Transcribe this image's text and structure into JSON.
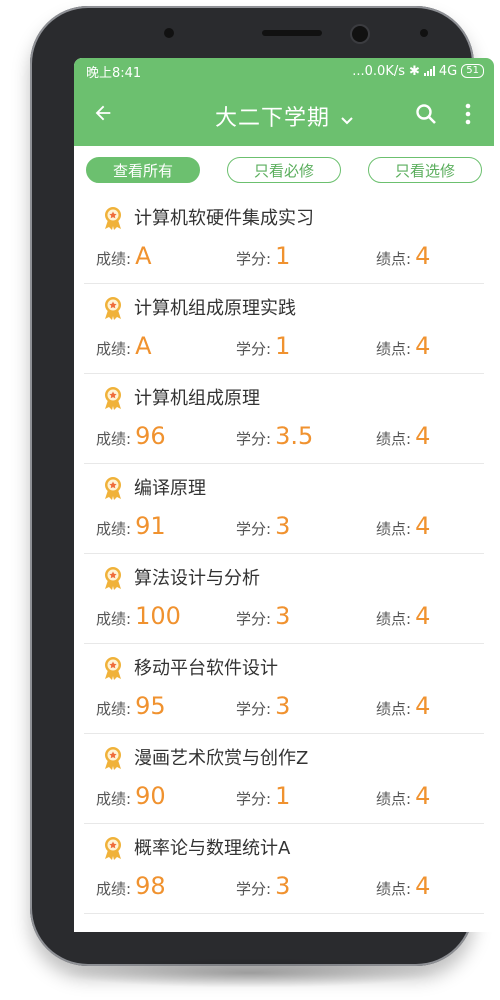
{
  "status": {
    "time": "晚上8:41",
    "net": "...0.0K/s",
    "signal": "4G",
    "battery": "51"
  },
  "header": {
    "title": "大二下学期"
  },
  "filters": [
    {
      "label": "查看所有",
      "active": true
    },
    {
      "label": "只看必修",
      "active": false
    },
    {
      "label": "只看选修",
      "active": false
    }
  ],
  "labels": {
    "score": "成绩:",
    "credit": "学分:",
    "gpa": "绩点:"
  },
  "courses": [
    {
      "name": "计算机软硬件集成实习",
      "score": "A",
      "credit": "1",
      "gpa": "4"
    },
    {
      "name": "计算机组成原理实践",
      "score": "A",
      "credit": "1",
      "gpa": "4"
    },
    {
      "name": "计算机组成原理",
      "score": "96",
      "credit": "3.5",
      "gpa": "4"
    },
    {
      "name": "编译原理",
      "score": "91",
      "credit": "3",
      "gpa": "4"
    },
    {
      "name": "算法设计与分析",
      "score": "100",
      "credit": "3",
      "gpa": "4"
    },
    {
      "name": "移动平台软件设计",
      "score": "95",
      "credit": "3",
      "gpa": "4"
    },
    {
      "name": "漫画艺术欣赏与创作Z",
      "score": "90",
      "credit": "1",
      "gpa": "4"
    },
    {
      "name": "概率论与数理统计A",
      "score": "98",
      "credit": "3",
      "gpa": "4"
    }
  ],
  "colors": {
    "primary": "#6cc06f",
    "accent": "#f0922f"
  }
}
